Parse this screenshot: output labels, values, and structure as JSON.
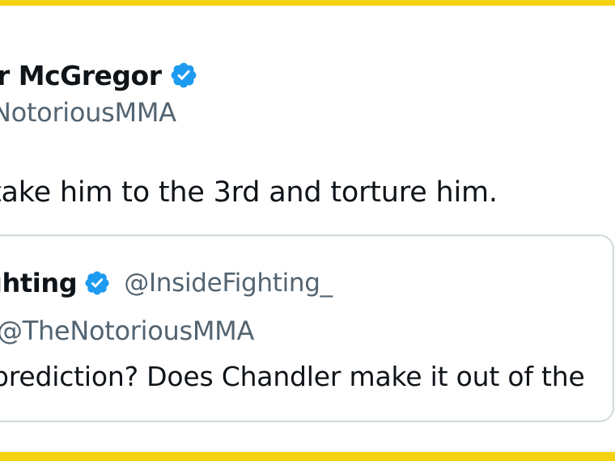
{
  "tweet": {
    "author_name": "r McGregor",
    "author_handle": "NotoriousMMA",
    "verified": true,
    "text": "take him to the 3rd and torture him."
  },
  "quoted_tweet": {
    "author_name": "ghting",
    "author_handle": "@InsideFighting_",
    "verified": true,
    "mention": "@TheNotoriousMMA",
    "text": "prediction? Does Chandler make it out of the"
  },
  "colors": {
    "accent_border": "#f5d20f",
    "verified_badge": "#1d9bf0",
    "text_primary": "#0f1419",
    "text_secondary": "#536471",
    "card_border": "#cfd9de"
  },
  "icons": {
    "verified": "verified-badge-icon"
  }
}
